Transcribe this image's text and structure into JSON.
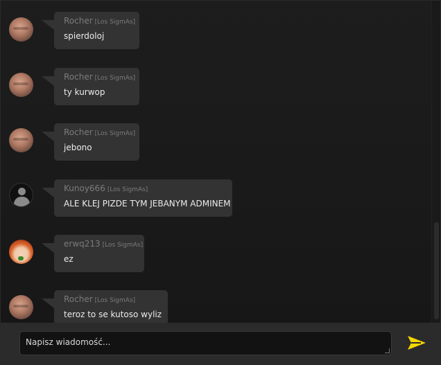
{
  "messages": [
    {
      "author": "Rocher",
      "clan": "[Los SigmAs]",
      "text": "spierdoloj",
      "avatar": "photo-avatar"
    },
    {
      "author": "Rocher",
      "clan": "[Los SigmAs]",
      "text": "ty kurwop",
      "avatar": "photo-avatar"
    },
    {
      "author": "Rocher",
      "clan": "[Los SigmAs]",
      "text": "jebono",
      "avatar": "photo-avatar"
    },
    {
      "author": "Kunoy666",
      "clan": "[Los SigmAs]",
      "text": "ALE KLEJ PIZDE TYM JEBANYM ADMINEM",
      "avatar": "default-user-icon"
    },
    {
      "author": "erwq213",
      "clan": "[Los SigmAs]",
      "text": "ez",
      "avatar": "anime-avatar"
    },
    {
      "author": "Rocher",
      "clan": "[Los SigmAs]",
      "text": "teroz to se kutoso wyliz",
      "avatar": "photo-avatar"
    }
  ],
  "composer": {
    "placeholder": "Napisz wiadomość...",
    "send_icon": "send-arrow-icon",
    "accent": "#f5d600"
  }
}
